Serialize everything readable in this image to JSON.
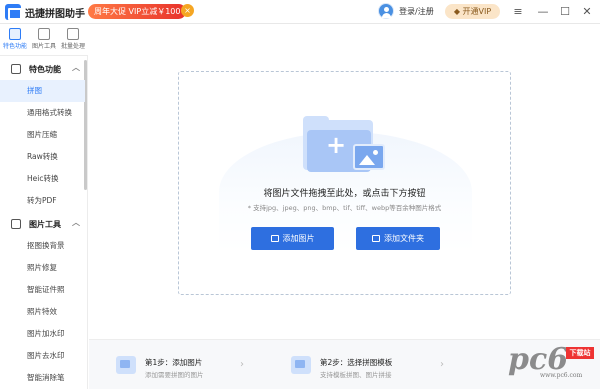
{
  "app": {
    "title": "迅捷拼图助手"
  },
  "promo": {
    "text": "周年大促 VIP立减￥100",
    "close": "×"
  },
  "header": {
    "login": "登录/注册",
    "vip": "开通VIP"
  },
  "window_controls": {
    "menu": "≡",
    "minimize": "—",
    "maximize": "☐",
    "close": "✕"
  },
  "top_tabs": [
    {
      "label": "特色功能",
      "icon": "feature-icon"
    },
    {
      "label": "图片工具",
      "icon": "image-tools-icon"
    },
    {
      "label": "批量处理",
      "icon": "batch-icon"
    }
  ],
  "sidebar": {
    "section1": {
      "label": "特色功能",
      "icon": "grid-icon",
      "chevron": "︿"
    },
    "section1_items": [
      "拼图",
      "通用格式转换",
      "图片压缩",
      "Raw转换",
      "Heic转换",
      "转为PDF"
    ],
    "section2": {
      "label": "图片工具",
      "icon": "tools-icon",
      "chevron": "︿"
    },
    "section2_items": [
      "抠图换背景",
      "照片修复",
      "智能证件照",
      "照片特效",
      "图片加水印",
      "图片去水印",
      "智能消除笔"
    ]
  },
  "dropzone": {
    "title": "将图片文件拖拽至此处，或点击下方按钮",
    "subtitle": "* 支持jpg、jpeg、png、bmp、tif、tiff、webp等百余种图片格式",
    "add_image": "添加图片",
    "add_folder": "添加文件夹"
  },
  "steps": [
    {
      "title": "第1步：添加图片",
      "sub": "添加需要拼图的图片"
    },
    {
      "title": "第2步：选择拼图模板",
      "sub": "支持模板拼图、图片拼接"
    }
  ],
  "step_arrow": "›",
  "watermark": {
    "big": "pc6",
    "red": "下载站",
    "small": "www.pc6.com"
  }
}
